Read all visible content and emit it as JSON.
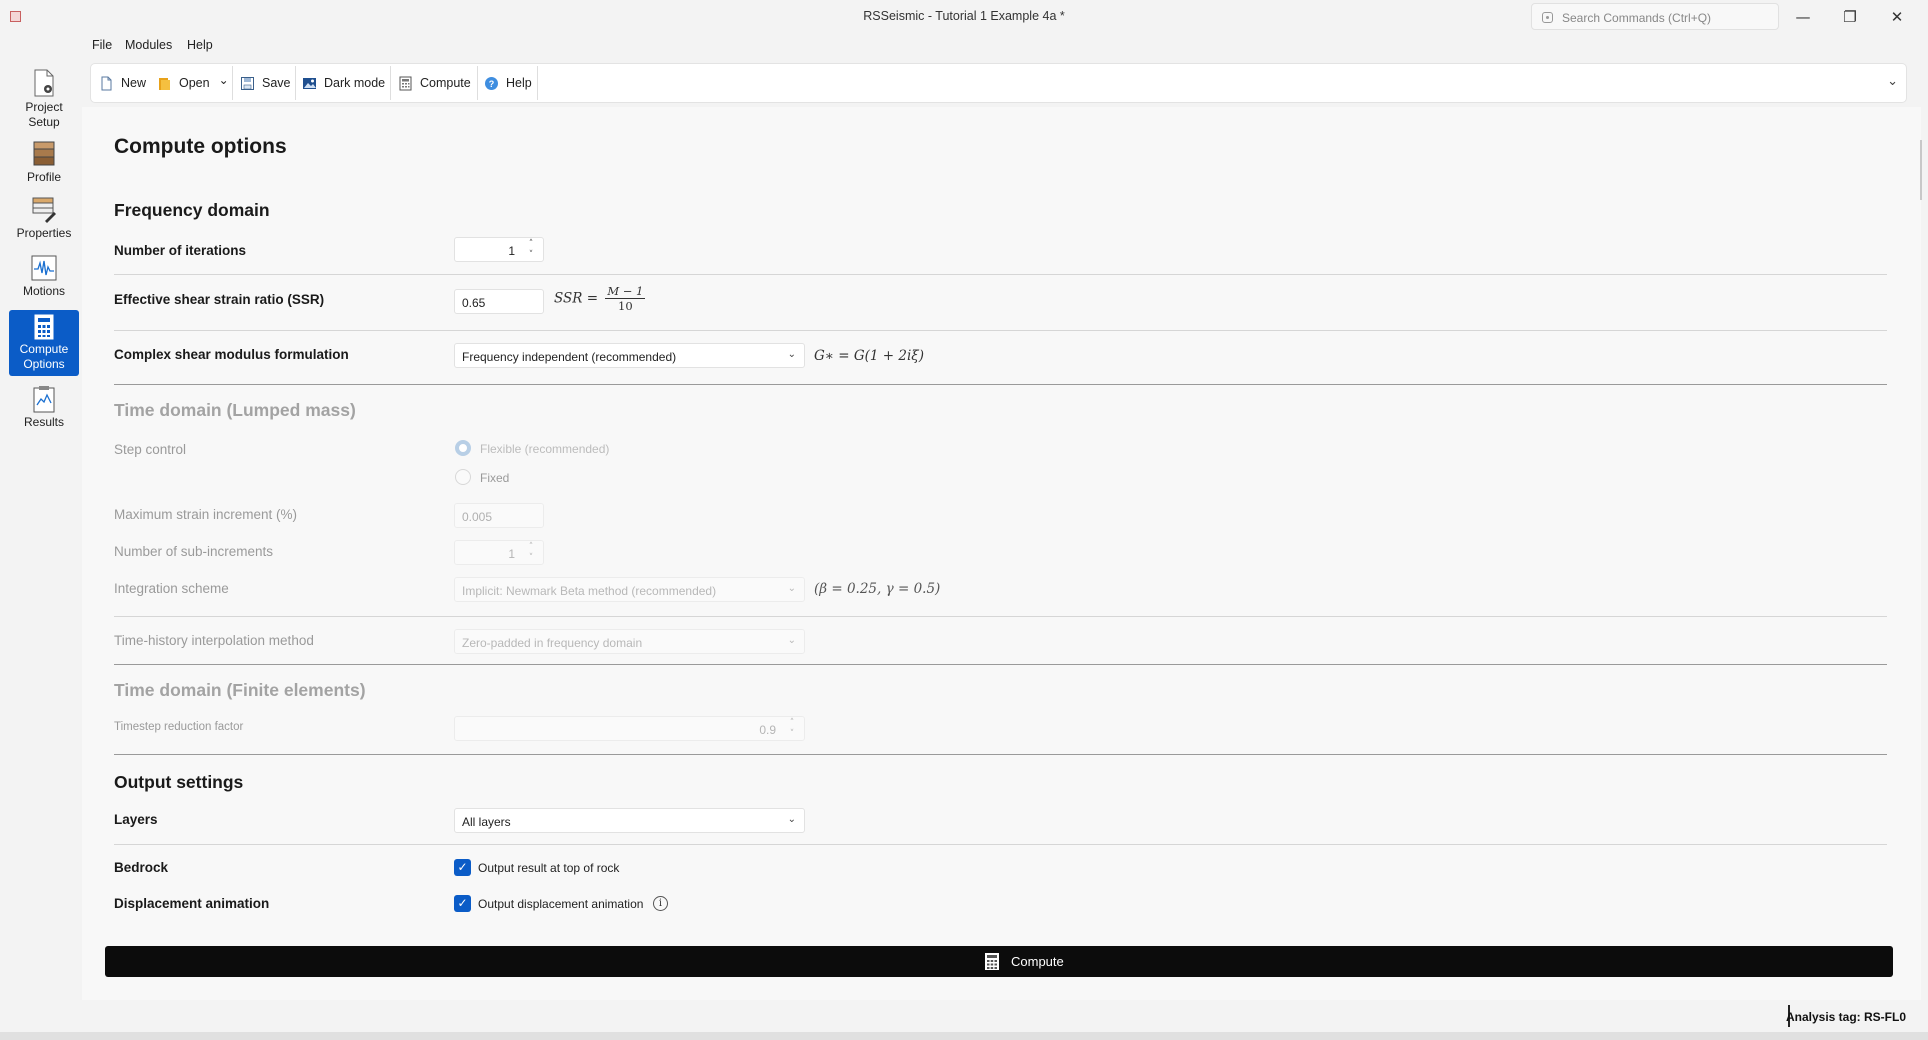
{
  "window": {
    "title": "RSSeismic - Tutorial 1 Example 4a *",
    "search_placeholder": "Search Commands (Ctrl+Q)",
    "controls": {
      "minimize": "—",
      "restore": "❐",
      "close": "✕"
    }
  },
  "menu": {
    "file": "File",
    "modules": "Modules",
    "help": "Help"
  },
  "toolbar": {
    "new": "New",
    "open": "Open",
    "save": "Save",
    "dark_mode": "Dark mode",
    "compute": "Compute",
    "help": "Help",
    "collapse_glyph": "⌄"
  },
  "nav": {
    "project_setup": [
      "Project",
      "Setup"
    ],
    "profile": "Profile",
    "properties": "Properties",
    "motions": "Motions",
    "compute_options": [
      "Compute",
      "Options"
    ],
    "results": "Results",
    "active": "compute_options"
  },
  "page": {
    "title": "Compute options"
  },
  "frequency_domain": {
    "heading": "Frequency domain",
    "iterations_label": "Number of iterations",
    "iterations_value": "1",
    "ssr_label": "Effective shear strain ratio (SSR)",
    "ssr_value": "0.65",
    "ssr_formula_lhs": "SSR =",
    "ssr_formula_num": "M − 1",
    "ssr_formula_den": "10",
    "modulus_label": "Complex shear modulus formulation",
    "modulus_value": "Frequency independent (recommended)",
    "modulus_formula": "G∗ = G(1 + 2iξ)"
  },
  "time_domain_lumped": {
    "heading": "Time domain (Lumped mass)",
    "step_control_label": "Step control",
    "step_options": [
      "Flexible (recommended)",
      "Fixed"
    ],
    "step_selected": "Flexible (recommended)",
    "max_strain_label": "Maximum strain increment (%)",
    "max_strain_value": "0.005",
    "sub_increments_label": "Number of sub-increments",
    "sub_increments_value": "1",
    "integration_label": "Integration scheme",
    "integration_value": "Implicit: Newmark Beta method (recommended)",
    "integration_formula": "(β = 0.25, γ = 0.5)",
    "interp_label": "Time-history interpolation method",
    "interp_value": "Zero-padded in frequency domain"
  },
  "time_domain_fe": {
    "heading": "Time domain (Finite elements)",
    "timestep_label": "Timestep reduction factor",
    "timestep_value": "0.9"
  },
  "output": {
    "heading": "Output settings",
    "layers_label": "Layers",
    "layers_value": "All layers",
    "bedrock_label": "Bedrock",
    "bedrock_check_label": "Output result at top of rock",
    "bedrock_checked": true,
    "disp_label": "Displacement animation",
    "disp_check_label": "Output displacement animation",
    "disp_checked": true
  },
  "compute_button": "Compute",
  "status": {
    "analysis_tag": "Analysis tag: RS-FL0"
  },
  "colors": {
    "accent": "#0b5cc7",
    "button_dark": "#0c0c0c"
  },
  "glyphs": {
    "chevron": "⌄",
    "check": "✓",
    "spin_up": "˄",
    "spin_down": "˅",
    "info": "i"
  }
}
